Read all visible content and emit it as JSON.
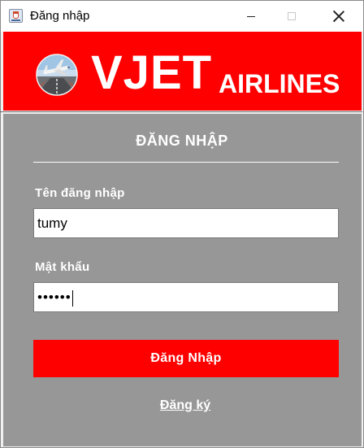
{
  "window": {
    "title": "Đăng nhập",
    "icon": "java-cup-icon",
    "controls": [
      "minimize-icon",
      "maximize-icon",
      "close-icon"
    ]
  },
  "banner": {
    "brand_main": "VJET",
    "brand_sub": "AIRLINES",
    "logo": "airplane-logo-icon",
    "background_color": "#ff0000"
  },
  "form": {
    "title": "ĐĂNG NHẬP",
    "username_label": "Tên đăng nhập",
    "username_value": "tumy",
    "password_label": "Mật khẩu",
    "password_value": "••••••",
    "login_button": "Đăng Nhập",
    "register_link": "Đăng ký",
    "panel_color": "#979797",
    "accent_color": "#ff0000"
  }
}
